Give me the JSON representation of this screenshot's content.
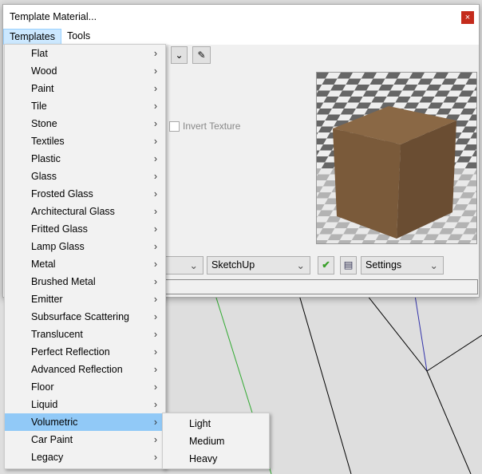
{
  "dialog": {
    "title": "Template Material...",
    "close": "×"
  },
  "menubar": {
    "items": [
      "Templates",
      "Tools"
    ]
  },
  "options": {
    "invert_texture": "Invert Texture"
  },
  "bottom": {
    "renderer": "SketchUp",
    "settings": "Settings",
    "left_combo": ""
  },
  "templates_menu": [
    "Flat",
    "Wood",
    "Paint",
    "Tile",
    "Stone",
    "Textiles",
    "Plastic",
    "Glass",
    "Frosted Glass",
    "Architectural Glass",
    "Fritted Glass",
    "Lamp Glass",
    "Metal",
    "Brushed Metal",
    "Emitter",
    "Subsurface Scattering",
    "Translucent",
    "Perfect Reflection",
    "Advanced Reflection",
    "Floor",
    "Liquid",
    "Volumetric",
    "Car Paint",
    "Legacy"
  ],
  "highlighted": "Volumetric",
  "volumetric_submenu": [
    "Light",
    "Medium",
    "Heavy"
  ],
  "colors": {
    "highlight": "#91c9f7",
    "cube": "#7a5a3a",
    "apply_check": "#3aa02a"
  }
}
